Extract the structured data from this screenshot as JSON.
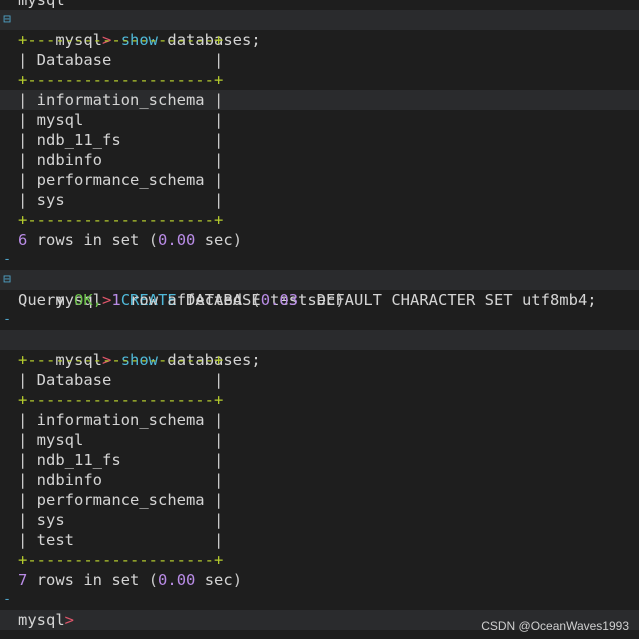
{
  "prompt": "mysql",
  "prompt_arrow": ">",
  "cmd1": {
    "keyword": "show",
    "rest": "databases;"
  },
  "border": "+--------------------+",
  "header": "Database",
  "list1": [
    "information_schema",
    "mysql",
    "ndb_11_fs",
    "ndbinfo",
    "performance_schema",
    "sys"
  ],
  "result1": {
    "count": "6",
    "text": "rows in set",
    "time": "0.00",
    "unit": "sec"
  },
  "cmd2": {
    "keyword": "CREATE",
    "rest": "DATABASE test DEFAULT CHARACTER SET utf8mb4;"
  },
  "query_ok": {
    "label": "Query",
    "ok": "OK,",
    "count": "1",
    "text": "row affected",
    "time": "0.03",
    "unit": "sec"
  },
  "cmd3": {
    "keyword": "show",
    "rest": "databases;"
  },
  "list2": [
    "information_schema",
    "mysql",
    "ndb_11_fs",
    "ndbinfo",
    "performance_schema",
    "sys",
    "test"
  ],
  "result2": {
    "count": "7",
    "text": "rows in set",
    "time": "0.00",
    "unit": "sec"
  },
  "gutter": {
    "collapse": "⊟",
    "dash": "-"
  },
  "watermark": "CSDN @OceanWaves1993"
}
